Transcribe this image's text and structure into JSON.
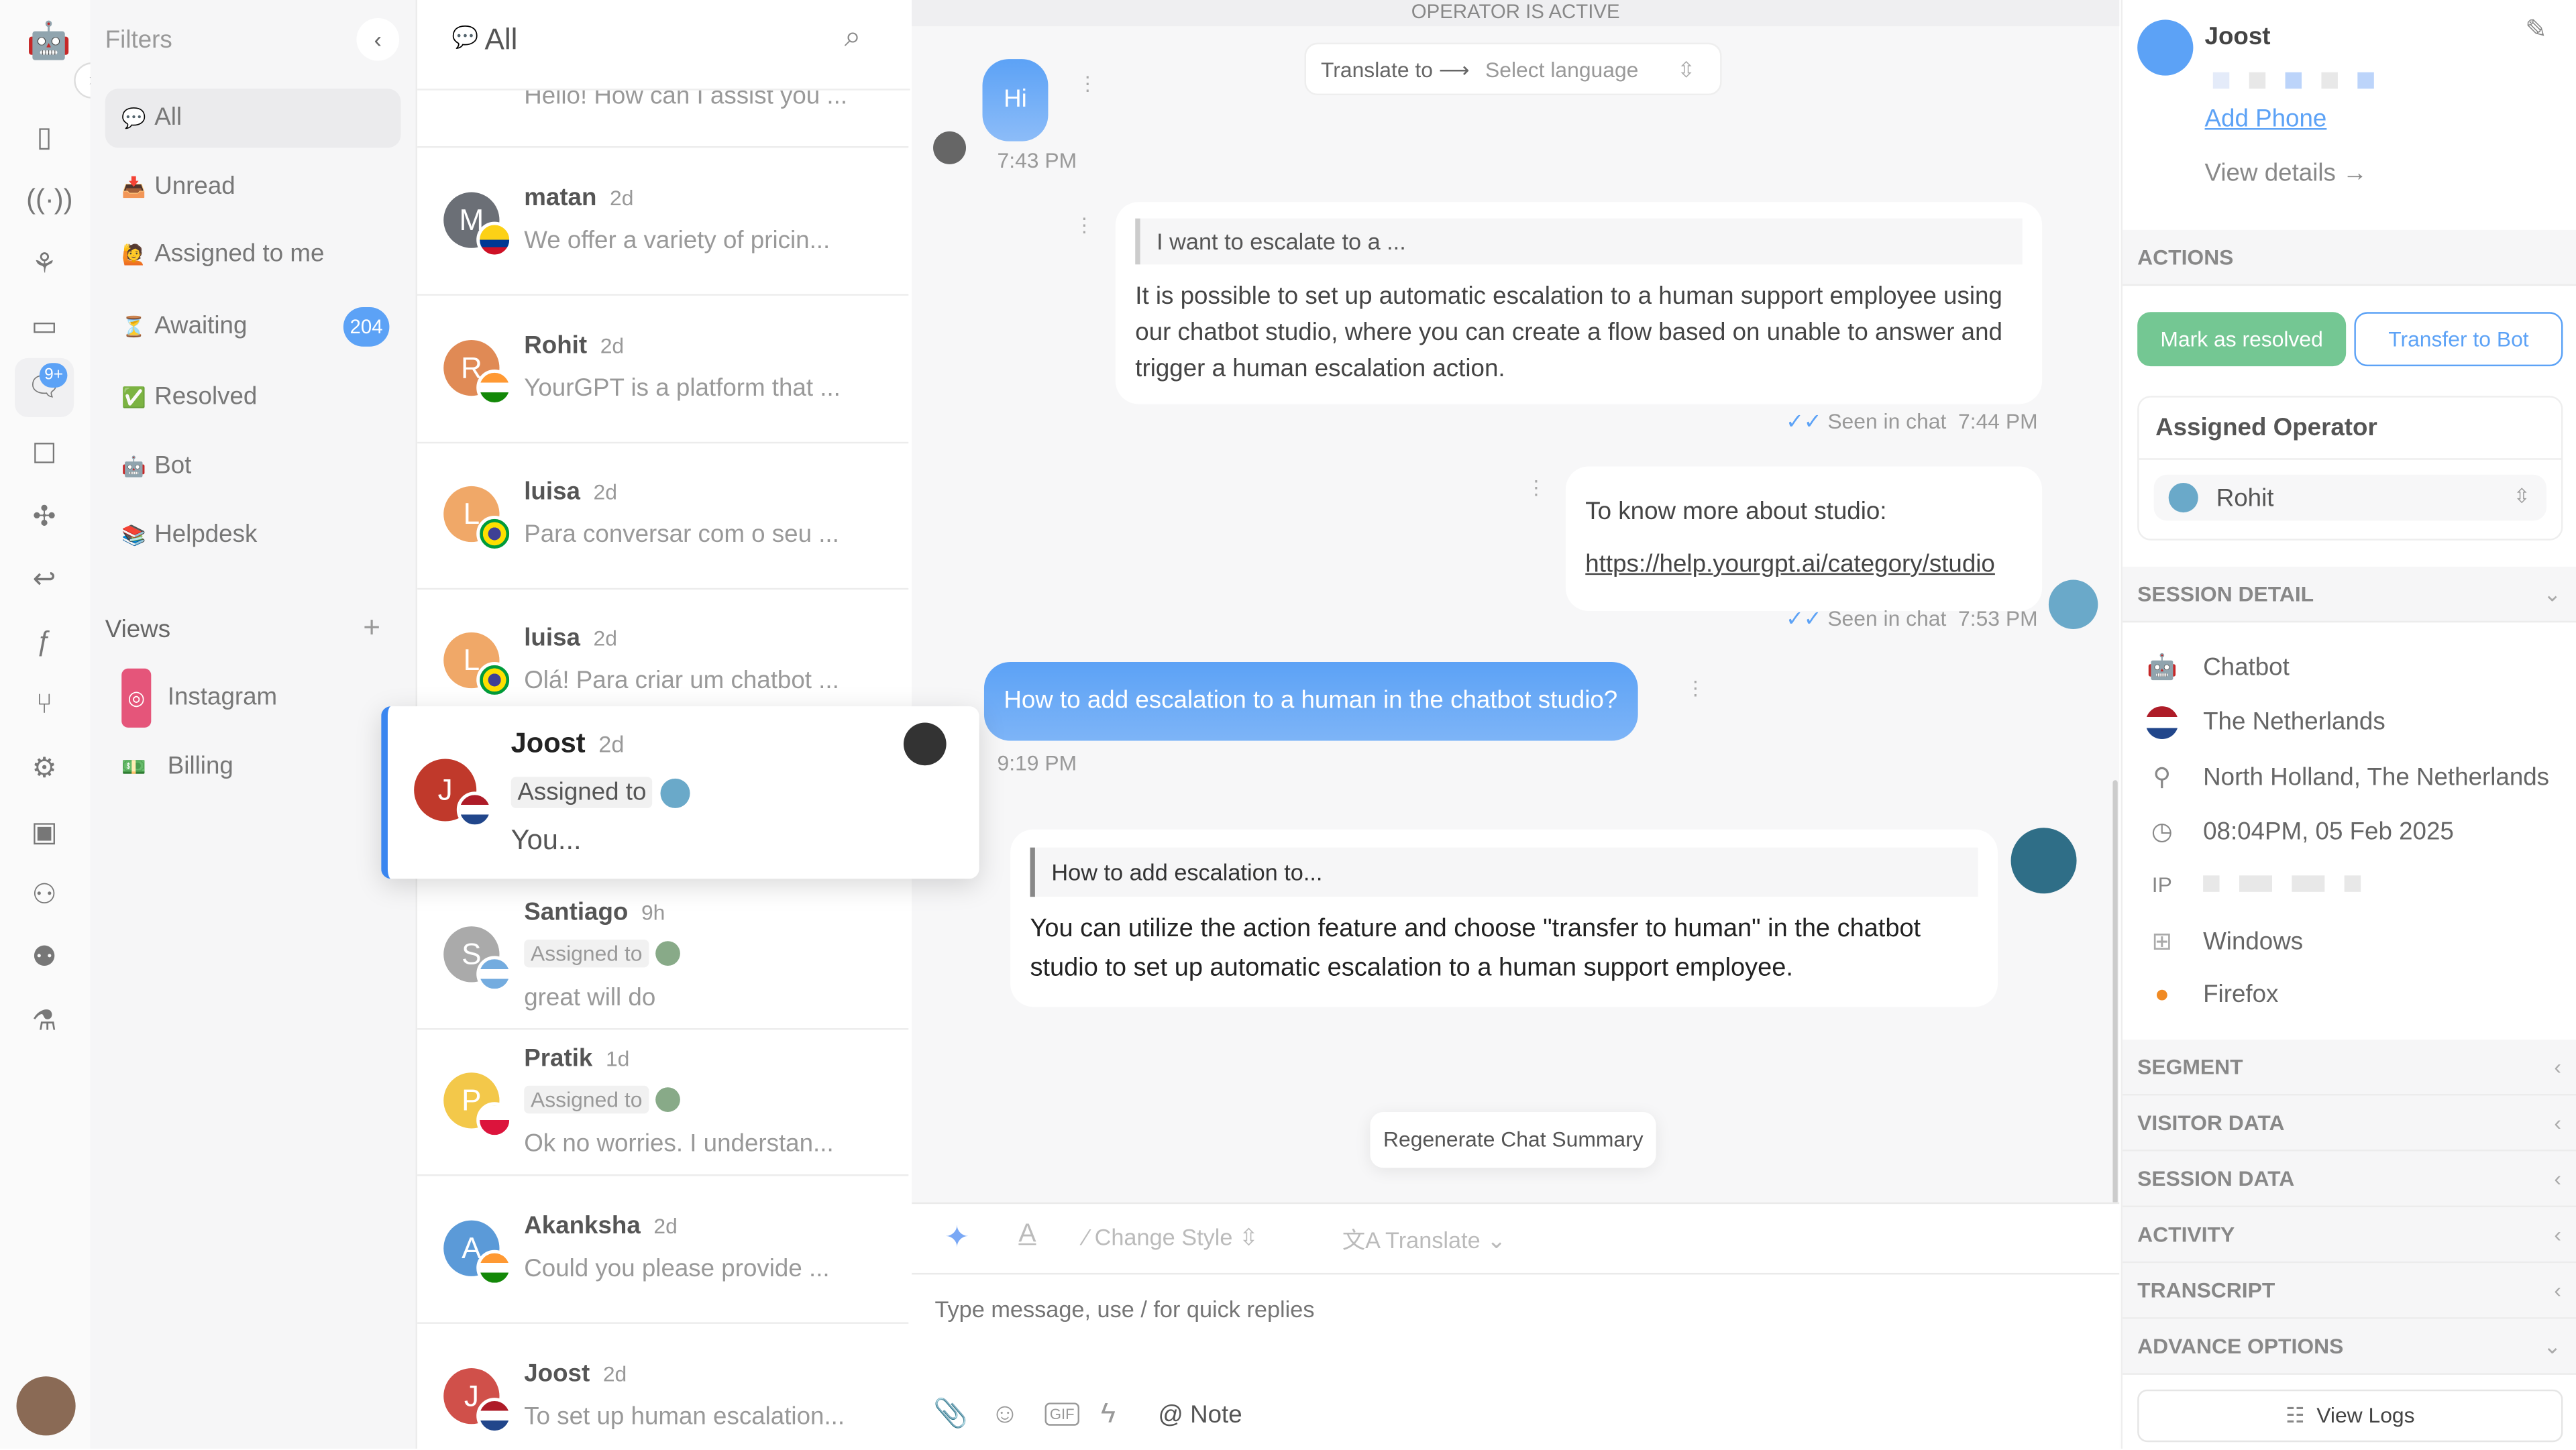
{
  "rail": {
    "notif_badge": "9+",
    "icons": [
      "bot-logo-icon",
      "expand-icon",
      "dashboard-icon",
      "broadcast-icon",
      "brain-icon",
      "book-icon",
      "chat-icon",
      "contacts-icon",
      "integrations-icon",
      "reply-icon",
      "function-icon",
      "flow-icon",
      "settings-icon",
      "bot-icon",
      "user-check-icon",
      "team-icon",
      "lab-icon"
    ]
  },
  "filters": {
    "title": "Filters",
    "items": [
      {
        "emoji": "💬",
        "label": "All"
      },
      {
        "emoji": "📥",
        "label": "Unread"
      },
      {
        "emoji": "🙋",
        "label": "Assigned to me"
      },
      {
        "emoji": "⏳",
        "label": "Awaiting",
        "count": "204"
      },
      {
        "emoji": "✅",
        "label": "Resolved"
      },
      {
        "emoji": "🤖",
        "label": "Bot"
      },
      {
        "emoji": "📚",
        "label": "Helpdesk"
      }
    ],
    "views_title": "Views",
    "views": [
      {
        "label": "Instagram"
      },
      {
        "label": "Billing"
      }
    ]
  },
  "list": {
    "title": "All",
    "top_partial": "Hello! How can I assist you ...",
    "items": [
      {
        "initial": "M",
        "name": "matan",
        "time": "2d",
        "msg": "We offer a variety of pricin...",
        "color": "#6b6f76"
      },
      {
        "initial": "R",
        "name": "Rohit",
        "time": "2d",
        "msg": "YourGPT is a platform that ...",
        "color": "#e08a55"
      },
      {
        "initial": "L",
        "name": "luisa",
        "time": "2d",
        "msg": "Para conversar com o seu ...",
        "color": "#f0a868"
      },
      {
        "initial": "L",
        "name": "luisa",
        "time": "2d",
        "msg": "Olá! Para criar um chatbot ...",
        "color": "#f0a868"
      },
      {
        "initial": "S",
        "name": "Santiago",
        "time": "9h",
        "assigned": "Assigned to",
        "msg": "great will do",
        "color": "#aaa"
      },
      {
        "initial": "P",
        "name": "Pratik",
        "time": "1d",
        "assigned": "Assigned to",
        "msg": "Ok no worries. I understan...",
        "color": "#f3c84a"
      },
      {
        "initial": "A",
        "name": "Akanksha",
        "time": "2d",
        "msg": "Could you please provide ...",
        "color": "#5b9ad8"
      },
      {
        "initial": "J",
        "name": "Joost",
        "time": "2d",
        "msg": "To set up human escalation...",
        "color": "#d0504a"
      }
    ],
    "selected": {
      "initial": "J",
      "name": "Joost",
      "time": "2d",
      "assigned": "Assigned to",
      "msg": "You..."
    }
  },
  "chat": {
    "banner": "OPERATOR IS ACTIVE",
    "translate_label": "Translate to ⟶",
    "translate_select": "Select language",
    "messages": [
      {
        "text": "Hi",
        "time": "7:43 PM"
      },
      {
        "quote": "I want to escalate to a ...",
        "text": "It is possible to set up automatic escalation to a human support employee using our chatbot studio, where you can create a flow based on unable to answer and trigger a human escalation action.",
        "seen": "Seen in chat",
        "time": "7:44 PM"
      },
      {
        "text": "To know more about studio:",
        "link": "https://help.yourgpt.ai/category/studio",
        "seen": "Seen in chat",
        "time": "7:53 PM"
      },
      {
        "text": "How to add escalation to a human in the chatbot studio?",
        "time": "9:19 PM"
      },
      {
        "quote": "How to add escalation to...",
        "text": "You can utilize the action feature and choose \"transfer to human\" in the chatbot studio to set up automatic escalation to a human support employee."
      }
    ],
    "regenerate": "Regenerate Chat Summary",
    "change_style": "Change Style",
    "translate": "Translate",
    "placeholder": "Type message, use / for quick replies",
    "note": "Note"
  },
  "right": {
    "name": "Joost",
    "add_phone": "Add Phone",
    "view_details": "View details →",
    "actions_title": "ACTIONS",
    "resolve": "Mark as resolved",
    "transfer": "Transfer to Bot",
    "assigned_title": "Assigned Operator",
    "operator": "Rohit",
    "session_title": "SESSION DETAIL",
    "session": [
      {
        "icon": "chatbot-icon",
        "text": "Chatbot"
      },
      {
        "icon": "netherlands-flag-icon",
        "text": "The Netherlands"
      },
      {
        "icon": "location-icon",
        "text": "North Holland, The Netherlands"
      },
      {
        "icon": "clock-icon",
        "text": "08:04PM, 05 Feb 2025"
      },
      {
        "icon": "ip-icon",
        "label": "IP"
      },
      {
        "icon": "windows-icon",
        "text": "Windows"
      },
      {
        "icon": "firefox-icon",
        "text": "Firefox"
      }
    ],
    "sections": [
      "SEGMENT",
      "VISITOR DATA",
      "SESSION DATA",
      "ACTIVITY",
      "TRANSCRIPT",
      "ADVANCE OPTIONS"
    ],
    "view_logs": "View Logs"
  },
  "colors": {
    "accent": "#5ca2f6",
    "resolve": "#74c793"
  }
}
